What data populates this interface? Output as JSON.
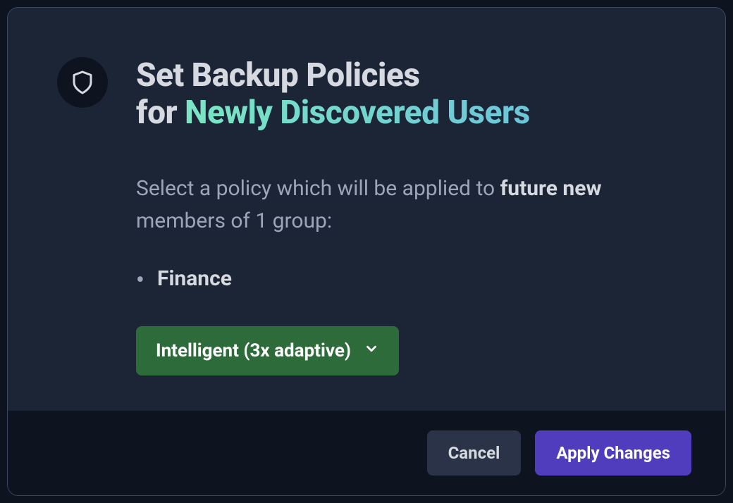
{
  "modal": {
    "title_line1": "Set Backup Policies",
    "title_prefix": "for ",
    "title_highlight": "Newly Discovered Users",
    "description_pre": "Select a policy which will be applied to ",
    "description_strong": "future new",
    "description_post": " members of 1 group:",
    "groups": [
      "Finance"
    ],
    "policy_selected": "Intelligent (3x adaptive)",
    "buttons": {
      "cancel": "Cancel",
      "apply": "Apply Changes"
    }
  }
}
